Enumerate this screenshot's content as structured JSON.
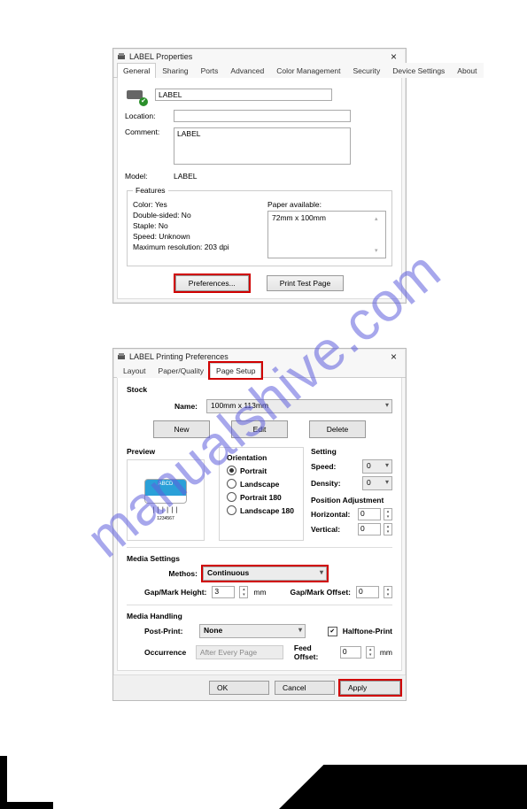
{
  "watermark": "manualshive.com",
  "dialog1": {
    "title": "LABEL Properties",
    "tabs": [
      "General",
      "Sharing",
      "Ports",
      "Advanced",
      "Color Management",
      "Security",
      "Device Settings",
      "About"
    ],
    "active_tab": 0,
    "name_value": "LABEL",
    "location_label": "Location:",
    "location_value": "",
    "comment_label": "Comment:",
    "comment_value": "LABEL",
    "model_label": "Model:",
    "model_value": "LABEL",
    "features_legend": "Features",
    "features_left": [
      "Color: Yes",
      "Double-sided: No",
      "Staple: No",
      "Speed: Unknown",
      "Maximum resolution: 203 dpi"
    ],
    "paper_label": "Paper available:",
    "paper_item": "72mm x 100mm",
    "btn_prefs": "Preferences...",
    "btn_test": "Print Test Page"
  },
  "dialog2": {
    "title": "LABEL Printing Preferences",
    "tabs": [
      "Layout",
      "Paper/Quality",
      "Page Setup"
    ],
    "active_tab": 2,
    "stock_label": "Stock",
    "name_label": "Name:",
    "name_value": "100mm x 113mm",
    "btn_new": "New",
    "btn_edit": "Edit",
    "btn_delete": "Delete",
    "preview_label": "Preview",
    "preview_text_top": "ABCD",
    "preview_text_bottom": "1234567",
    "orientation_label": "Orientation",
    "orientation_options": [
      "Portrait",
      "Landscape",
      "Portrait 180",
      "Landscape 180"
    ],
    "orientation_selected": 0,
    "setting_label": "Setting",
    "speed_label": "Speed:",
    "speed_value": "0",
    "density_label": "Density:",
    "density_value": "0",
    "posadj_label": "Position Adjustment",
    "horizontal_label": "Horizontal:",
    "horizontal_value": "0",
    "vertical_label": "Vertical:",
    "vertical_value": "0",
    "media_settings_label": "Media Settings",
    "method_label": "Methos:",
    "method_value": "Continuous",
    "gap_height_label": "Gap/Mark Height:",
    "gap_height_value": "3",
    "gap_height_unit": "mm",
    "gap_offset_label": "Gap/Mark Offset:",
    "gap_offset_value": "0",
    "media_handling_label": "Media Handling",
    "postprint_label": "Post-Print:",
    "postprint_value": "None",
    "halftone_label": "Halftone-Print",
    "occurrence_label": "Occurrence",
    "occurrence_value": "After Every Page",
    "feed_offset_label": "Feed Offset:",
    "feed_offset_value": "0",
    "feed_offset_unit": "mm",
    "btn_ok": "OK",
    "btn_cancel": "Cancel",
    "btn_apply": "Apply"
  }
}
